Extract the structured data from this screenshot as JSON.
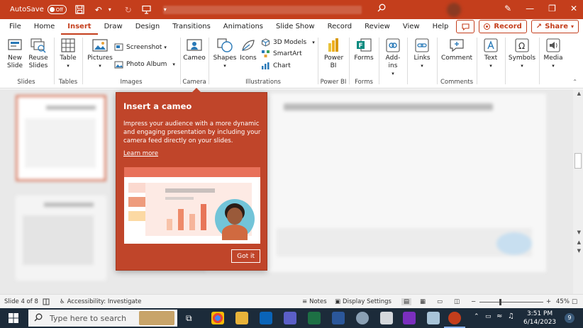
{
  "titlebar": {
    "autosave_label": "AutoSave",
    "autosave_state": "Off"
  },
  "tabs": [
    "File",
    "Home",
    "Insert",
    "Draw",
    "Design",
    "Transitions",
    "Animations",
    "Slide Show",
    "Record",
    "Review",
    "View",
    "Help"
  ],
  "active_tab": "Insert",
  "tab_actions": {
    "record_label": "Record",
    "share_label": "Share"
  },
  "ribbon": {
    "new_slide": "New Slide",
    "reuse_slides": "Reuse Slides",
    "table": "Table",
    "pictures": "Pictures",
    "screenshot": "Screenshot",
    "photo_album": "Photo Album",
    "cameo": "Cameo",
    "shapes": "Shapes",
    "icons": "Icons",
    "models_3d": "3D Models",
    "smartart": "SmartArt",
    "chart": "Chart",
    "power_bi": "Power BI",
    "forms": "Forms",
    "addins": "Add-ins",
    "links": "Links",
    "comment": "Comment",
    "text": "Text",
    "symbols": "Symbols",
    "media": "Media",
    "groups": {
      "slides": "Slides",
      "tables": "Tables",
      "images": "Images",
      "camera": "Camera",
      "illustrations": "Illustrations",
      "power_bi": "Power BI",
      "forms": "Forms",
      "comments": "Comments"
    }
  },
  "popup": {
    "title": "Insert a cameo",
    "body": "Impress your audience with a more dynamic and engaging presentation by including your camera feed directly on your slides.",
    "link": "Learn more",
    "button": "Got it"
  },
  "status": {
    "slide_info": "Slide 4 of 8",
    "accessibility": "Accessibility: Investigate",
    "notes": "Notes",
    "display_settings": "Display Settings",
    "zoom": "45%"
  },
  "taskbar": {
    "search_placeholder": "Type here to search",
    "time": "3:51 PM",
    "date": "6/14/2023",
    "notification_count": "9"
  },
  "colors": {
    "brand": "#c43e1c",
    "popup": "#c0452a",
    "taskbar": "#1c2b3a"
  }
}
